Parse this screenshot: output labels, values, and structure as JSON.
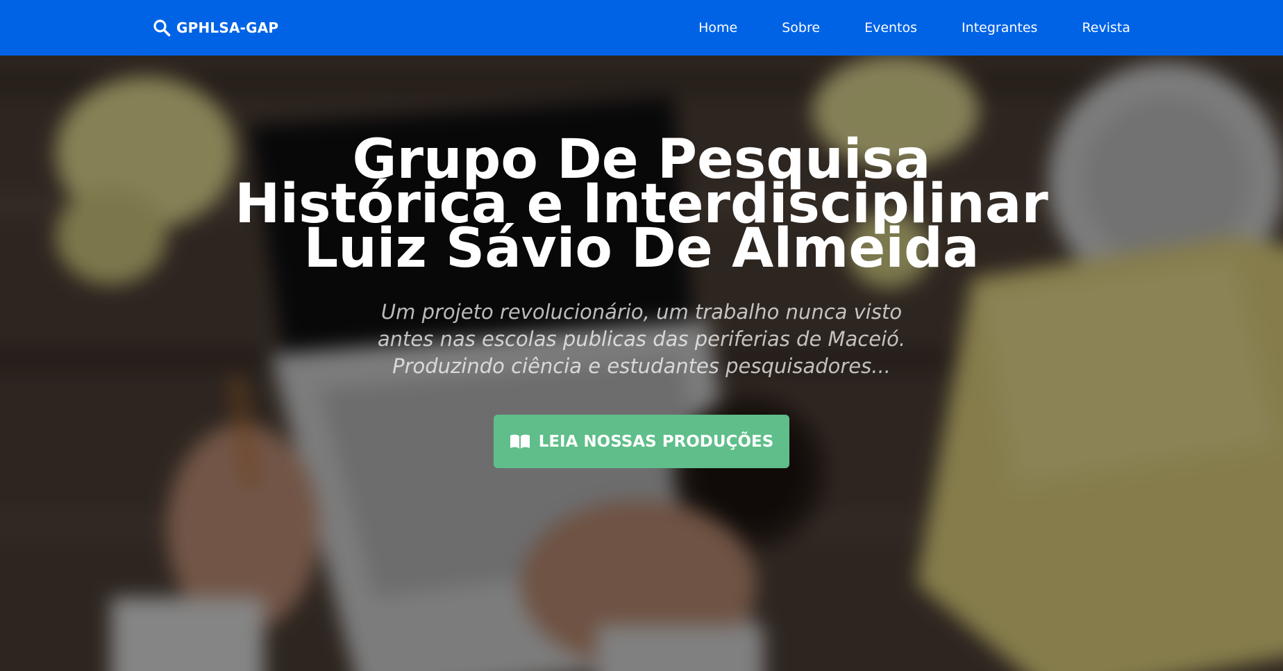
{
  "navbar": {
    "brand": "GPHLSA-GAP",
    "brand_icon": "search-icon",
    "background_color": "#0063e6",
    "links": [
      {
        "label": "Home"
      },
      {
        "label": "Sobre"
      },
      {
        "label": "Eventos"
      },
      {
        "label": "Integrantes"
      },
      {
        "label": "Revista"
      }
    ]
  },
  "hero": {
    "title": "Grupo De Pesquisa Histórica e Interdisciplinar Luiz Sávio De Almeida",
    "subtitle": "Um projeto revolucionário, um trabalho nunca visto antes nas escolas publicas das periferias de Maceió. Produzindo ciência e estudantes pesquisadores...",
    "button_label": "LEIA NOSSAS PRODUÇÕES",
    "button_icon": "book-icon",
    "button_color": "#5fbe8a"
  }
}
